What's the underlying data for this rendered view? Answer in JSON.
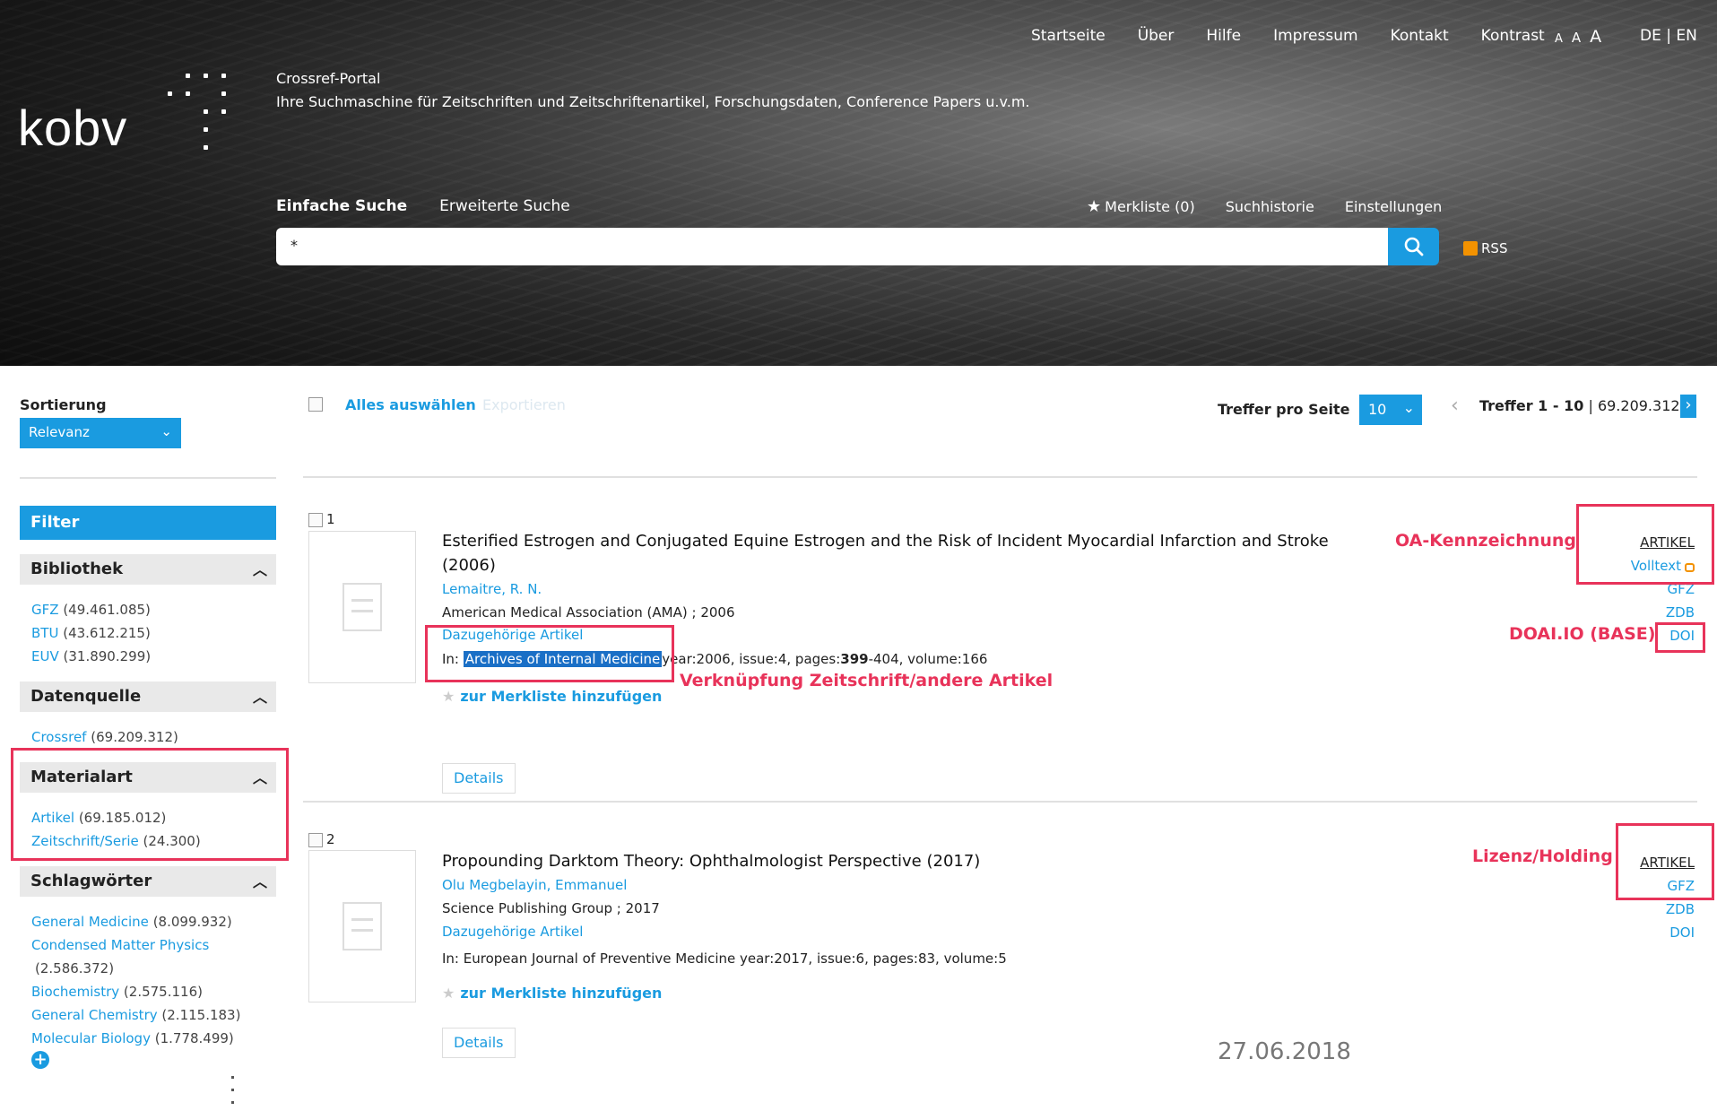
{
  "header": {
    "topnav": [
      "Startseite",
      "Über",
      "Hilfe",
      "Impressum",
      "Kontakt",
      "Kontrast"
    ],
    "fontsize": [
      "A",
      "A",
      "A"
    ],
    "lang": "DE | EN",
    "logo": "kobv",
    "portal_title": "Crossref-Portal",
    "portal_subtitle": "Ihre Suchmaschine für Zeitschriften und Zeitschriftenartikel, Forschungsdaten, Conference Papers u.v.m.",
    "tabs": [
      "Einfache Suche",
      "Erweiterte Suche"
    ],
    "tools": [
      "Merkliste (0)",
      "Suchhistorie",
      "Einstellungen"
    ],
    "search_value": "*",
    "rss": "RSS"
  },
  "sidebar": {
    "sort_label": "Sortierung",
    "sort_value": "Relevanz",
    "filter_label": "Filter",
    "groups": [
      {
        "title": "Bibliothek",
        "items": [
          {
            "label": "GFZ",
            "count": "(49.461.085)"
          },
          {
            "label": "BTU",
            "count": "(43.612.215)"
          },
          {
            "label": "EUV",
            "count": "(31.890.299)"
          }
        ]
      },
      {
        "title": "Datenquelle",
        "items": [
          {
            "label": "Crossref",
            "count": "(69.209.312)"
          }
        ]
      },
      {
        "title": "Materialart",
        "items": [
          {
            "label": "Artikel",
            "count": "(69.185.012)"
          },
          {
            "label": "Zeitschrift/Serie",
            "count": "(24.300)"
          }
        ]
      },
      {
        "title": "Schlagwörter",
        "items": [
          {
            "label": "General Medicine",
            "count": "(8.099.932)"
          },
          {
            "label": "Condensed Matter Physics",
            "count": "(2.586.372)"
          },
          {
            "label": "Biochemistry",
            "count": "(2.575.116)"
          },
          {
            "label": "General Chemistry",
            "count": "(2.115.183)"
          },
          {
            "label": "Molecular Biology",
            "count": "(1.778.499)"
          }
        ]
      }
    ]
  },
  "toolbar": {
    "select_all": "Alles auswählen",
    "export": "Exportieren",
    "per_page_label": "Treffer pro Seite",
    "per_page_value": "10",
    "range": "Treffer 1 - 10",
    "total": "69.209.312"
  },
  "results": [
    {
      "num": "1",
      "title_line1": "Esterified Estrogen and Conjugated Equine Estrogen and the Risk of Incident Myocardial Infarction and Stroke",
      "title_line2": "(2006)",
      "author": "Lemaitre, R. N.",
      "publisher": "American Medical Association (AMA) ; 2006",
      "related": "Dazugehörige Artikel",
      "in_label": "In:",
      "journal": "Archives of Internal Medicine",
      "meta_pre": "year:2006, issue:4, pages:",
      "meta_bold": "399",
      "meta_post": "-404, volume:166",
      "merkliste": "zur Merkliste hinzufügen",
      "details": "Details",
      "side": {
        "type": "ARTIKEL",
        "links": [
          "Volltext",
          "GFZ",
          "ZDB",
          "DOI"
        ]
      }
    },
    {
      "num": "2",
      "title_line1": "Propounding Darktom Theory: Ophthalmologist Perspective (2017)",
      "author": "Olu Megbelayin, Emmanuel",
      "publisher": "Science Publishing Group ; 2017",
      "related": "Dazugehörige Artikel",
      "in_line": "In:  European Journal of Preventive Medicine year:2017, issue:6, pages:83, volume:5",
      "merkliste": "zur Merkliste hinzufügen",
      "details": "Details",
      "side": {
        "type": "ARTIKEL",
        "links": [
          "GFZ",
          "ZDB",
          "DOI"
        ]
      }
    }
  ],
  "annotations": {
    "oa": "OA-Kennzeichnung",
    "doai": "DOAI.IO (BASE)",
    "link": "Verknüpfung Zeitschrift/andere Artikel",
    "lizenz": "Lizenz/Holding"
  },
  "date": "27.06.2018",
  "colors": {
    "accent": "#1a9be0",
    "annotation": "#e8335a",
    "oa_lock": "#f39200"
  }
}
